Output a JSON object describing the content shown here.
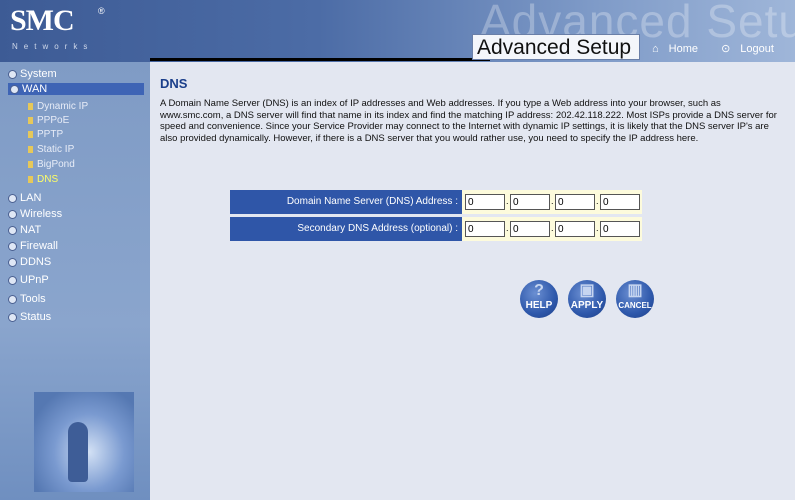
{
  "header": {
    "logo": "SMC",
    "logo_sub": "Networks",
    "logo_reg": "®",
    "watermark": "Advanced Setup",
    "page_heading": "Advanced Setup",
    "home_label": "Home",
    "logout_label": "Logout"
  },
  "sidebar": {
    "items": [
      {
        "label": "System"
      },
      {
        "label": "WAN"
      },
      {
        "label": "LAN"
      },
      {
        "label": "Wireless"
      },
      {
        "label": "NAT"
      },
      {
        "label": "Firewall"
      },
      {
        "label": "DDNS"
      },
      {
        "label": "UPnP"
      },
      {
        "label": "Tools"
      },
      {
        "label": "Status"
      }
    ],
    "wan_subitems": [
      {
        "label": "Dynamic IP"
      },
      {
        "label": "PPPoE"
      },
      {
        "label": "PPTP"
      },
      {
        "label": "Static IP"
      },
      {
        "label": "BigPond"
      },
      {
        "label": "DNS"
      }
    ]
  },
  "main": {
    "title": "DNS",
    "description": "A Domain Name Server (DNS) is an index of IP addresses and Web addresses. If you type a Web address into your browser, such as www.smc.com, a DNS server will find that name in its index and find the matching IP address: 202.42.118.222. Most ISPs provide a DNS server for speed and convenience. Since your Service Provider may connect to the Internet with dynamic IP settings, it is likely that the DNS server IP's are also provided dynamically. However, if there is a DNS server that you would rather use, you need to specify the IP address here.",
    "primary_label": "Domain Name Server (DNS) Address :",
    "secondary_label": "Secondary DNS Address (optional) :",
    "primary_octets": [
      "0",
      "0",
      "0",
      "0"
    ],
    "secondary_octets": [
      "0",
      "0",
      "0",
      "0"
    ],
    "help_label": "HELP",
    "apply_label": "APPLY",
    "cancel_label": "CANCEL"
  }
}
